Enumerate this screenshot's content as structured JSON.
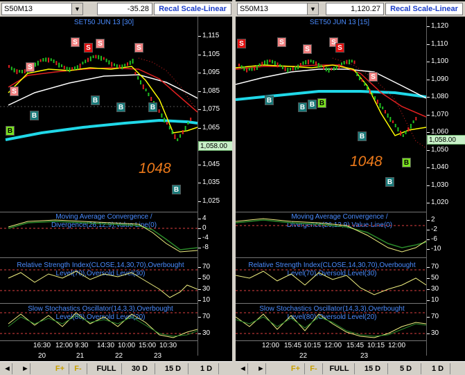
{
  "left": {
    "symbol": "S50M13",
    "value": "-35.28",
    "recal": "Recal Scale-Linear",
    "title": "SET50 JUN 13   [30]",
    "yticks": [
      "1,115",
      "1,105",
      "1,095",
      "1,085",
      "1,075",
      "1,065",
      "1,055",
      "1,045",
      "1,035",
      "1,025"
    ],
    "last": "1,058.00",
    "big": "1048",
    "macd_title": "Moving Average Convergence /\nDivergence(26,12,9),Value Line(0)",
    "macd_ticks": [
      "4",
      "0",
      "-4",
      "-8"
    ],
    "rsi_title": "Relative Strength Index(CLOSE,14,30,70),Overbought\nLevel(70),Oversold Level(30)",
    "rsi_ticks": [
      "70",
      "50",
      "30",
      "10"
    ],
    "sto_title": "Slow Stochastics Oscillator(14,3,3),Overbought\nLevel(80),Oversold Level(20)",
    "sto_ticks": [
      "70",
      "30"
    ],
    "times": [
      "16:30",
      "12:00",
      "9:30",
      "14:30",
      "10:00",
      "15:00",
      "10:30"
    ],
    "days": [
      "20",
      "21",
      "22",
      "23"
    ],
    "buttons": [
      "FULL",
      "30 D",
      "15 D",
      "1 D"
    ]
  },
  "right": {
    "symbol": "S50M13",
    "value": "1,120.27",
    "recal": "Recal Scale-Linear",
    "title": "SET50 JUN 13   [15]",
    "yticks": [
      "1,120",
      "1,110",
      "1,100",
      "1,090",
      "1,080",
      "1,070",
      "1,060",
      "1,050",
      "1,040",
      "1,030",
      "1,020"
    ],
    "last": "1,058.00",
    "big": "1048",
    "macd_title": "Moving Average Convergence /\nDivergence(26,12,9),Value Line(0)",
    "macd_ticks": [
      "2",
      "-2",
      "-6",
      "-10"
    ],
    "rsi_title": "Relative Strength Index(CLOSE,14,30,70),Overbought\nLevel(70),Oversold Level(30)",
    "rsi_ticks": [
      "70",
      "50",
      "30",
      "10"
    ],
    "sto_title": "Slow Stochastics Oscillator(14,3,3),Overbought\nLevel(80),Oversold Level(20)",
    "sto_ticks": [
      "70",
      "30"
    ],
    "times": [
      "12:00",
      "15:45",
      "10:15",
      "12:00",
      "15:45",
      "10:15",
      "12:00"
    ],
    "days": [
      "22",
      "23"
    ],
    "buttons": [
      "FULL",
      "15 D",
      "5 D",
      "1 D"
    ]
  },
  "ff": [
    "F+",
    "F-"
  ],
  "signals": {
    "s": "S",
    "b": "B"
  },
  "colors": {
    "sma_fast": "#ffff00",
    "sma_mid": "#e02020",
    "sma_slow": "#ffffff",
    "sma_long": "#20d8e8",
    "up": "#20c020",
    "down": "#e02020",
    "signal": "#f0f080",
    "line": "#2a8a2a",
    "level": "#e04040"
  }
}
